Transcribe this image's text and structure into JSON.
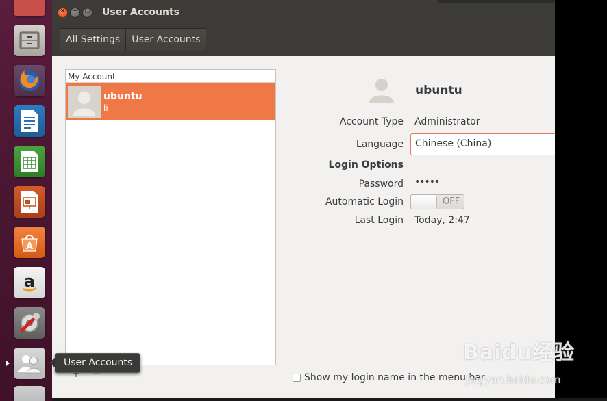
{
  "window": {
    "title": "User Accounts",
    "close_symbol": "×",
    "minimize_symbol": "–",
    "maximize_symbol": "□"
  },
  "breadcrumbs": [
    "All Settings",
    "User Accounts"
  ],
  "account_list": {
    "header": "My Account",
    "accounts": [
      {
        "name": "ubuntu",
        "subtitle": "li",
        "selected": true
      }
    ],
    "add_label": "+",
    "remove_label": "−"
  },
  "details": {
    "username": "ubuntu",
    "account_type_label": "Account Type",
    "account_type_value": "Administrator",
    "language_label": "Language",
    "language_value": "Chinese (China)",
    "login_options_label": "Login Options",
    "password_label": "Password",
    "password_value": "•••••",
    "automatic_login_label": "Automatic Login",
    "automatic_login_state": "OFF",
    "last_login_label": "Last Login",
    "last_login_value": "Today,  2:47",
    "show_login_name_label": "Show my login name in the menu bar",
    "show_login_name_checked": false
  },
  "launcher": {
    "items": [
      "top-app-icon",
      "files-icon",
      "firefox-icon",
      "writer-icon",
      "calc-icon",
      "impress-icon",
      "software-center-icon",
      "amazon-icon",
      "system-settings-icon",
      "user-accounts-icon",
      "bottom-app-icon"
    ],
    "tooltip": "User Accounts"
  },
  "watermark": {
    "logo": "Baidu经验",
    "url": "jingyan.baidu.com"
  },
  "colors": {
    "launcher_bg": "#4c1733",
    "titlebar_bg": "#3c3b37",
    "selected_row": "#f07746",
    "accent_border": "#e07b5a"
  }
}
